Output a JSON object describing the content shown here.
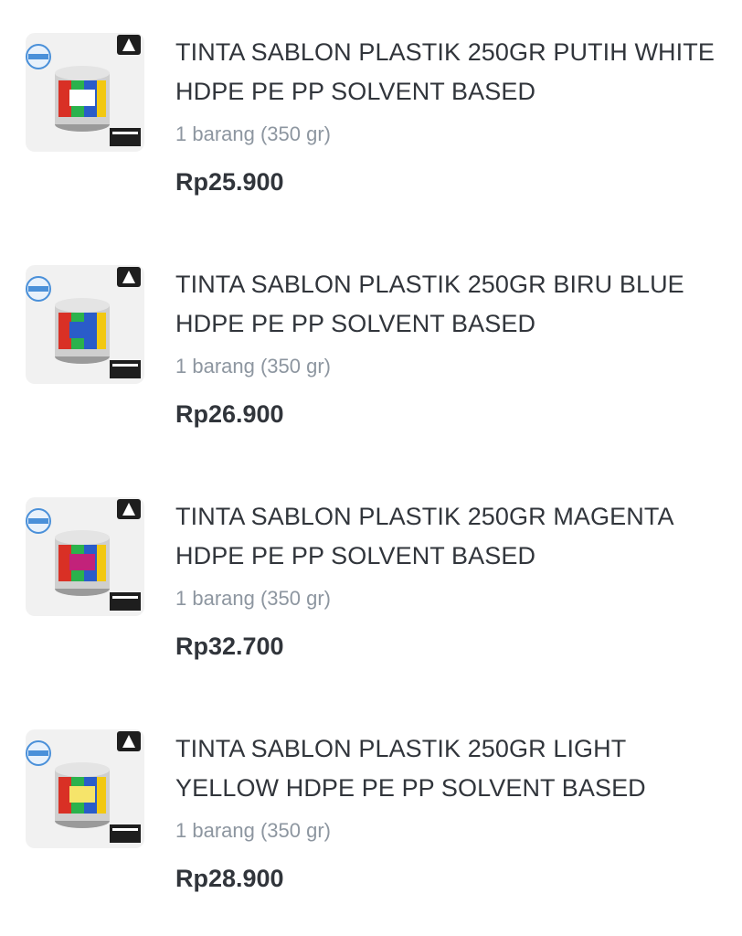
{
  "products": [
    {
      "title": "TINTA SABLON PLASTIK 250GR PUTIH WHITE HDPE PE PP SOLVENT BASED",
      "quantity": "1 barang (350 gr)",
      "price": "Rp25.900"
    },
    {
      "title": "TINTA SABLON PLASTIK 250GR BIRU BLUE HDPE PE PP SOLVENT BASED",
      "quantity": "1 barang (350 gr)",
      "price": "Rp26.900"
    },
    {
      "title": "TINTA SABLON PLASTIK 250GR MAGENTA HDPE PE PP SOLVENT BASED",
      "quantity": "1 barang (350 gr)",
      "price": "Rp32.700"
    },
    {
      "title": "TINTA SABLON PLASTIK 250GR LIGHT YELLOW HDPE PE PP SOLVENT BASED",
      "quantity": "1 barang (350 gr)",
      "price": "Rp28.900"
    }
  ],
  "colors": {
    "title_text": "#31353b",
    "secondary_text": "#8d96a0",
    "price_text": "#31353b"
  }
}
